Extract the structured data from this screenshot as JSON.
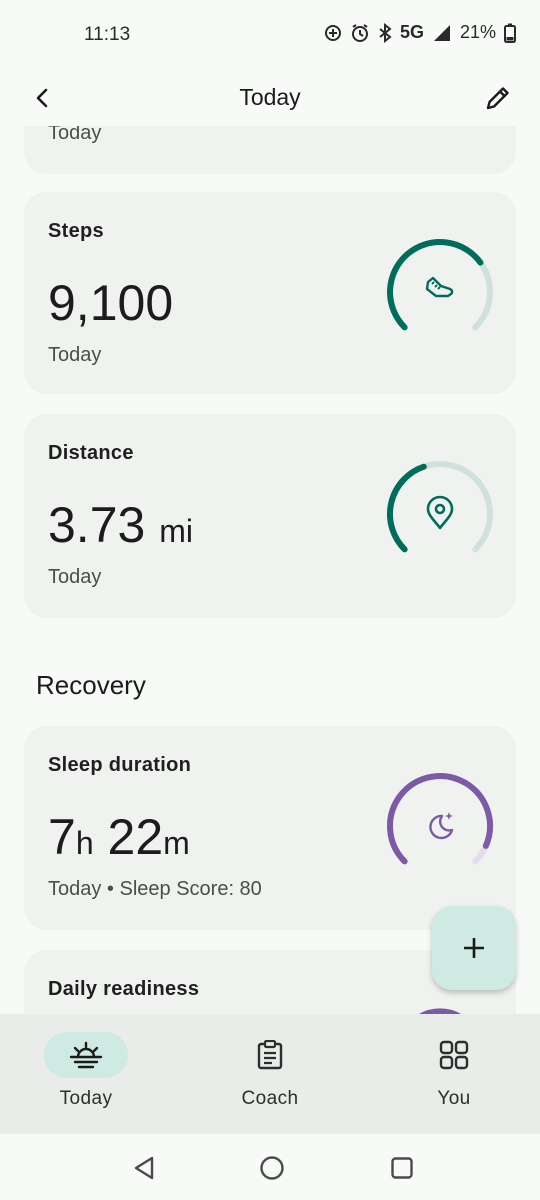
{
  "status_bar": {
    "time": "11:13",
    "network": "5G",
    "battery": "21%"
  },
  "app_bar": {
    "title": "Today"
  },
  "cards": {
    "partial_top": {
      "subtitle": "Today"
    },
    "steps": {
      "title": "Steps",
      "value": "9,100",
      "subtitle": "Today",
      "progress": 0.7,
      "ring_color": "#006c5b",
      "track_color": "#cfe1dc",
      "icon": "shoe-icon"
    },
    "distance": {
      "title": "Distance",
      "value": "3.73",
      "unit": "mi",
      "subtitle": "Today",
      "progress": 0.43,
      "ring_color": "#006c5b",
      "track_color": "#cfe1dc",
      "icon": "location-pin-icon"
    },
    "sleep": {
      "title": "Sleep duration",
      "hours": "7",
      "hours_unit": "h",
      "minutes": "22",
      "minutes_unit": "m",
      "subtitle": "Today • Sleep Score: 80",
      "progress": 0.92,
      "ring_color": "#7b5aa6",
      "track_color": "#e3dcec",
      "icon": "moon-stars-icon"
    },
    "readiness": {
      "title": "Daily readiness",
      "ring_color": "#7b5aa6"
    }
  },
  "sections": {
    "recovery": "Recovery"
  },
  "fab": {
    "icon": "plus-icon"
  },
  "bottom_nav": [
    {
      "label": "Today",
      "icon": "sunrise-icon",
      "active": true
    },
    {
      "label": "Coach",
      "icon": "clipboard-icon",
      "active": false
    },
    {
      "label": "You",
      "icon": "grid-icon",
      "active": false
    }
  ]
}
